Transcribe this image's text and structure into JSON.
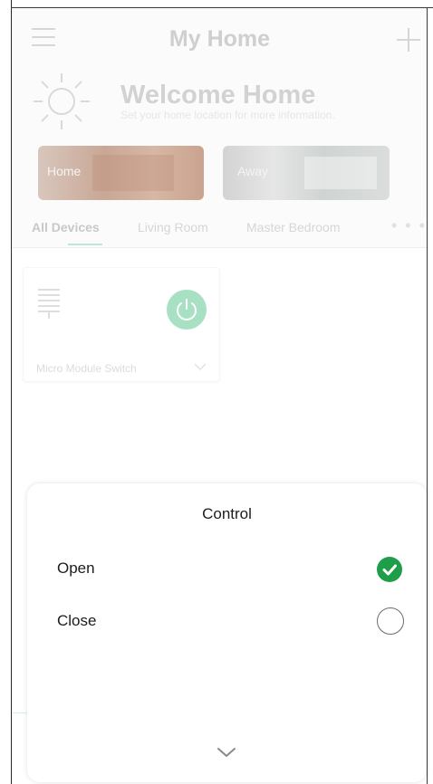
{
  "header": {
    "title": "My Home",
    "welcome_title": "Welcome Home",
    "welcome_subtitle": "Set your home location for more information."
  },
  "scenes": [
    {
      "label": "Home"
    },
    {
      "label": "Away"
    }
  ],
  "tabs": [
    {
      "label": "All Devices"
    },
    {
      "label": "Living Room"
    },
    {
      "label": "Master Bedroom"
    },
    {
      "label": "• • •"
    }
  ],
  "device": {
    "name": "Micro Module Switch",
    "power_state": "on"
  },
  "control_sheet": {
    "title": "Control",
    "options": [
      {
        "label": "Open",
        "selected": true
      },
      {
        "label": "Close",
        "selected": false
      }
    ]
  },
  "colors": {
    "accent_green": "#1f9e4a",
    "power_green": "#a8e0c4"
  }
}
